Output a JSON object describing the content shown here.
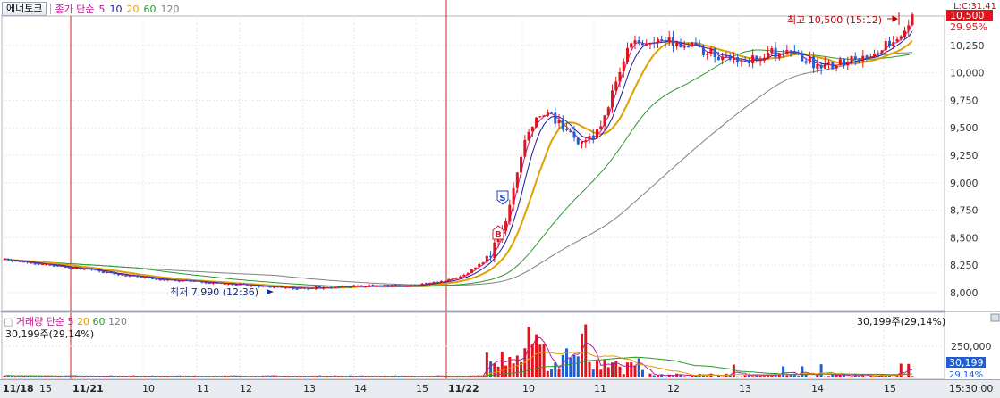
{
  "header": {
    "stock_name": "에너토크",
    "price_legend": {
      "prefix": "종가 단순",
      "periods": [
        "5",
        "10",
        "20",
        "60",
        "120"
      ]
    },
    "volume_legend": {
      "prefix": "거래량 단순",
      "periods": [
        "5",
        "20",
        "60",
        "120"
      ]
    },
    "corner_label": "L:C:31.41"
  },
  "price_panel": {
    "high_annotation": "최고 10,500 (15:12)",
    "low_annotation": "최저 7,990 (12:36)",
    "current_price": "10,500",
    "current_pct": "29.95%",
    "y_ticks": [
      "10,250",
      "10,000",
      "9,750",
      "9,500",
      "9,250",
      "9,000",
      "8,750",
      "8,500",
      "8,250",
      "8,000"
    ],
    "signal_buy": "B",
    "signal_sell": "S"
  },
  "volume_panel": {
    "current_volume_left": "30,199주(29,14%)",
    "current_volume_right": "30,199주(29,14%)",
    "y_tick": "250,000",
    "current_value": "30,199",
    "current_pct": "29,14%"
  },
  "x_axis": {
    "labels": [
      "11/18",
      "15",
      "11/21",
      "10",
      "11",
      "12",
      "13",
      "14",
      "15",
      "11/22",
      "10",
      "11",
      "12",
      "13",
      "14",
      "15"
    ],
    "time": "15:30:00"
  },
  "colors": {
    "up": "#e0141e",
    "down": "#1f5fd1",
    "ma5": "#c01890",
    "ma10": "#1a1aa0",
    "ma20": "#e0a000",
    "ma60": "#2a9a2a",
    "ma120": "#808080"
  },
  "chart_data": {
    "type": "candlestick",
    "title": "에너토크",
    "ylim": [
      7900,
      10550
    ],
    "day_markers": [
      "11/21",
      "11/22"
    ],
    "close_trend": [
      [
        0,
        8300
      ],
      [
        5,
        8270
      ],
      [
        10,
        8230
      ],
      [
        15,
        8190
      ],
      [
        20,
        8150
      ],
      [
        25,
        8120
      ],
      [
        30,
        8100
      ],
      [
        35,
        8080
      ],
      [
        40,
        8060
      ],
      [
        45,
        8040
      ],
      [
        50,
        8050
      ],
      [
        55,
        8060
      ],
      [
        60,
        8060
      ],
      [
        65,
        8070
      ],
      [
        70,
        8120
      ],
      [
        73,
        8200
      ],
      [
        76,
        8330
      ],
      [
        78,
        8600
      ],
      [
        80,
        9000
      ],
      [
        82,
        9500
      ],
      [
        84,
        9650
      ],
      [
        86,
        9580
      ],
      [
        88,
        9450
      ],
      [
        90,
        9380
      ],
      [
        92,
        9420
      ],
      [
        94,
        9600
      ],
      [
        96,
        9980
      ],
      [
        98,
        10300
      ],
      [
        100,
        10250
      ],
      [
        104,
        10280
      ],
      [
        108,
        10230
      ],
      [
        112,
        10150
      ],
      [
        116,
        10120
      ],
      [
        120,
        10180
      ],
      [
        124,
        10150
      ],
      [
        128,
        10050
      ],
      [
        132,
        10100
      ],
      [
        136,
        10200
      ],
      [
        140,
        10300
      ],
      [
        142,
        10500
      ]
    ],
    "volume_note": "peak bars about 480,000 at 11/22 09:xx and 10:5x"
  }
}
